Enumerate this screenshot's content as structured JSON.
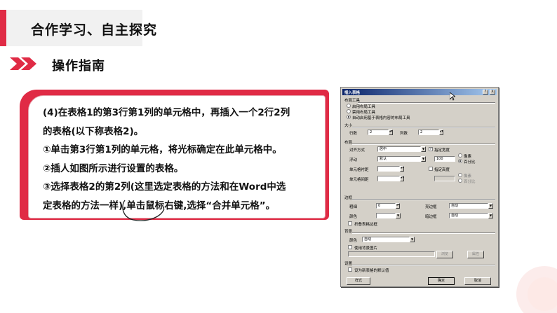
{
  "header": {
    "title": "合作学习、自主探究",
    "subtitle": "操作指南"
  },
  "card": {
    "lines": [
      "(4)在表格1的第3行第1列的单元格中，再插入一个2行2列",
      "的表格(以下称表格2)。",
      "①单击第3行第1列的单元格，将光标确定在此单元格中。",
      "②插人如图所示进行设置的表格。",
      "③选择表格2的第2列(这里选定表格的方法和在Word中选",
      "定表格的方法一样),单击鼠标右键,选择“合并单元格”。"
    ]
  },
  "colors": {
    "accent": "#e02b45",
    "dialog_bg": "#d4d0c8",
    "titlebar": "#0a246a"
  },
  "dialog": {
    "title": "插入表格",
    "help_btn": "?",
    "close_btn": "X",
    "layout_tool": {
      "label": "布局工具",
      "options": [
        "启用布局工具",
        "禁用布局工具",
        "自动启用基于表格内容的布局工具"
      ],
      "selected_index": 2
    },
    "size": {
      "label": "大小",
      "rows_label": "行数",
      "rows_value": "2",
      "cols_label": "列数",
      "cols_value": "2"
    },
    "layout": {
      "label": "布局",
      "align_label": "对齐方式",
      "align_value": "居中",
      "float_label": "浮动",
      "float_value": "默认",
      "cell_spacing_label": "单元格衬距",
      "cell_padding_label": "单元格间距",
      "width_label": "指定宽度",
      "width_value": "100",
      "pixel_label": "像素",
      "percent_label": "百分比",
      "height_label": "指定高度",
      "pixel2_label": "像素",
      "percent2_label": "百分比"
    },
    "border": {
      "label": "边框",
      "thickness_label": "粗细",
      "thickness_value": "0",
      "color_label": "颜色",
      "light_label": "亮边框",
      "light_value": "自动",
      "dark_label": "暗边框",
      "dark_value": "自动",
      "collapse_label": "折叠表格边框"
    },
    "background": {
      "label": "背景",
      "color_label": "颜色",
      "color_value": "自动",
      "use_image_label": "使用背景图片",
      "browse_btn": "浏览",
      "properties_btn": "属性"
    },
    "settings": {
      "label": "设置",
      "default_label": "设为新表格的默认值"
    },
    "buttons": {
      "style": "样式",
      "ok": "确定",
      "cancel": "取消"
    }
  }
}
